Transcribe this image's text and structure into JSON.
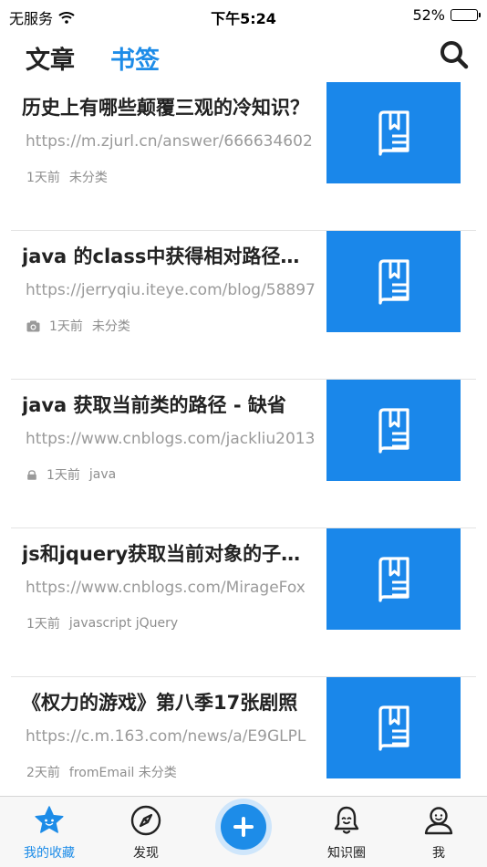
{
  "status_bar": {
    "carrier": "无服务",
    "time": "下午5:24",
    "battery": "52%",
    "battery_level": 0.52
  },
  "header": {
    "tabs": [
      {
        "label": "文章",
        "active": false
      },
      {
        "label": "书签",
        "active": true
      }
    ],
    "search_icon": "search-icon"
  },
  "bookmarks": [
    {
      "title": "历史上有哪些颠覆三观的冷知识？",
      "url": "https://m.zjurl.cn/answer/666634602",
      "meta_icon": "",
      "time": "1天前",
      "tags": "未分类",
      "thumb_icon": "bookmark-book-icon"
    },
    {
      "title": "java 的class中获得相对路径的方法",
      "url": "https://jerryqiu.iteye.com/blog/58897",
      "meta_icon": "camera-icon",
      "time": "1天前",
      "tags": "未分类",
      "thumb_icon": "bookmark-book-icon"
    },
    {
      "title": "java 获取当前类的路径 - 缺省",
      "url": "https://www.cnblogs.com/jackliu2013",
      "meta_icon": "lock-icon",
      "time": "1天前",
      "tags": "java",
      "thumb_icon": "bookmark-book-icon"
    },
    {
      "title": "js和jquery获取当前对象的子元素",
      "url": "https://www.cnblogs.com/MirageFox",
      "meta_icon": "",
      "time": "1天前",
      "tags": "javascript jQuery",
      "thumb_icon": "bookmark-book-icon"
    },
    {
      "title": "《权力的游戏》第八季17张剧照",
      "url": "https://c.m.163.com/news/a/E9GLPL",
      "meta_icon": "",
      "time": "2天前",
      "tags": "fromEmail 未分类",
      "thumb_icon": "bookmark-book-icon"
    }
  ],
  "tab_bar": {
    "items": [
      {
        "label": "我的收藏",
        "icon": "star-icon",
        "active": true
      },
      {
        "label": "发现",
        "icon": "compass-icon",
        "active": false
      },
      {
        "label": "",
        "icon": "plus-icon",
        "active": false
      },
      {
        "label": "知识圈",
        "icon": "bell-icon",
        "active": false
      },
      {
        "label": "我",
        "icon": "user-icon",
        "active": false
      }
    ]
  },
  "colors": {
    "accent": "#1d8ce8",
    "thumb_bg": "#1a87ea",
    "title_text": "#222222",
    "url_text": "#9a9a9a",
    "meta_text": "#8e8e8e"
  }
}
